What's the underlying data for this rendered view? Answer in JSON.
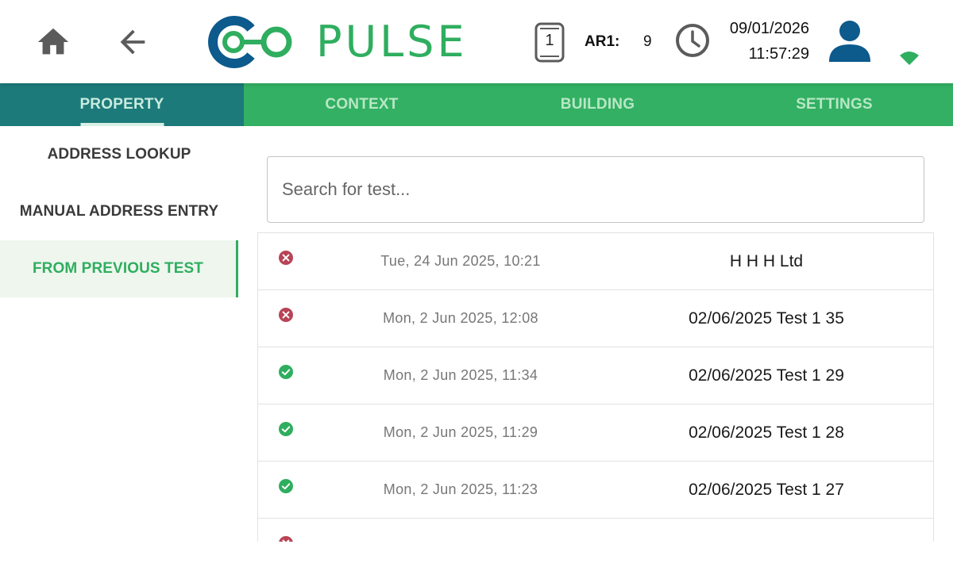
{
  "header": {
    "logo_text": "PULSE",
    "device_number": "1",
    "ar_label": "AR1:",
    "ar_value": "9",
    "date": "09/01/2026",
    "time": "11:57:29",
    "colors": {
      "brand_green": "#2fae5f",
      "brand_blue": "#0d5a8c",
      "icon_gray": "#5b5b5b"
    }
  },
  "tabs": [
    {
      "label": "PROPERTY",
      "active": true
    },
    {
      "label": "CONTEXT",
      "active": false
    },
    {
      "label": "BUILDING",
      "active": false
    },
    {
      "label": "SETTINGS",
      "active": false
    }
  ],
  "side_menu": [
    {
      "label": "ADDRESS LOOKUP",
      "active": false
    },
    {
      "label": "MANUAL ADDRESS ENTRY",
      "active": false
    },
    {
      "label": "FROM PREVIOUS TEST",
      "active": true
    }
  ],
  "search": {
    "placeholder": "Search for test...",
    "value": ""
  },
  "tests": [
    {
      "status": "failed",
      "status_icon": "error-circle-icon",
      "date": "Tue, 24 Jun 2025, 10:21",
      "name": "H H H Ltd"
    },
    {
      "status": "failed",
      "status_icon": "error-circle-icon",
      "date": "Mon, 2 Jun 2025, 12:08",
      "name": "02/06/2025 Test 1 35"
    },
    {
      "status": "passed",
      "status_icon": "check-circle-icon",
      "date": "Mon, 2 Jun 2025, 11:34",
      "name": "02/06/2025 Test 1 29"
    },
    {
      "status": "passed",
      "status_icon": "check-circle-icon",
      "date": "Mon, 2 Jun 2025, 11:29",
      "name": "02/06/2025 Test 1 28"
    },
    {
      "status": "passed",
      "status_icon": "check-circle-icon",
      "date": "Mon, 2 Jun 2025, 11:23",
      "name": "02/06/2025 Test 1 27"
    },
    {
      "status": "failed",
      "status_icon": "error-circle-icon",
      "date": "",
      "name": ""
    }
  ],
  "status_colors": {
    "failed": "#b84456",
    "passed": "#2fae5f"
  }
}
